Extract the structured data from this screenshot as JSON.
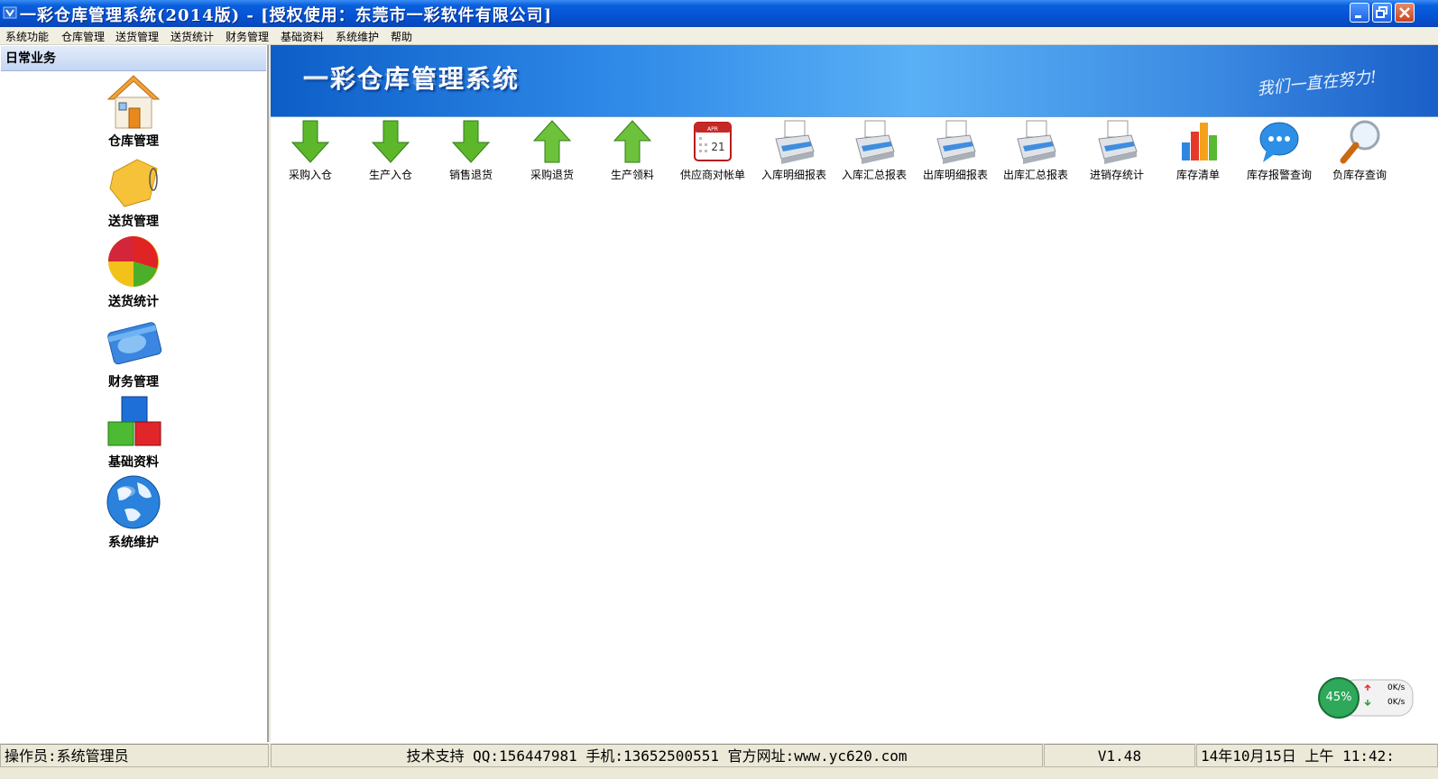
{
  "window": {
    "title": "一彩仓库管理系统(2014版) - [授权使用：东莞市一彩软件有限公司]"
  },
  "menu": [
    "系统功能",
    "仓库管理",
    "送货管理",
    "送货统计",
    "财务管理",
    "基础资料",
    "系统维护",
    "帮助"
  ],
  "sidebar": {
    "header": "日常业务",
    "items": [
      {
        "label": "仓库管理",
        "icon": "house-icon"
      },
      {
        "label": "送货管理",
        "icon": "tag-icon"
      },
      {
        "label": "送货统计",
        "icon": "pie-chart-icon"
      },
      {
        "label": "财务管理",
        "icon": "card-icon"
      },
      {
        "label": "基础资料",
        "icon": "blocks-icon"
      },
      {
        "label": "系统维护",
        "icon": "globe-icon"
      }
    ]
  },
  "banner": {
    "title": "一彩仓库管理系统",
    "slogan": "我们一直在努力!"
  },
  "toolbar": [
    {
      "label": "采购入仓",
      "icon": "arrow-down-icon"
    },
    {
      "label": "生产入仓",
      "icon": "arrow-down-icon"
    },
    {
      "label": "销售退货",
      "icon": "arrow-down-icon"
    },
    {
      "label": "采购退货",
      "icon": "arrow-up-icon"
    },
    {
      "label": "生产领料",
      "icon": "arrow-up-icon"
    },
    {
      "label": "供应商对帐单",
      "icon": "calendar-icon"
    },
    {
      "label": "入库明细报表",
      "icon": "printer-icon"
    },
    {
      "label": "入库汇总报表",
      "icon": "printer-icon"
    },
    {
      "label": "出库明细报表",
      "icon": "printer-icon"
    },
    {
      "label": "出库汇总报表",
      "icon": "printer-icon"
    },
    {
      "label": "进销存统计",
      "icon": "printer-icon"
    },
    {
      "label": "库存清单",
      "icon": "bar-chart-icon"
    },
    {
      "label": "库存报警查询",
      "icon": "speech-bubble-icon"
    },
    {
      "label": "负库存查询",
      "icon": "magnifier-icon"
    }
  ],
  "calendar": {
    "month": "APR",
    "day": "21"
  },
  "network": {
    "percent": "45%",
    "up": "0K/s",
    "down": "0K/s"
  },
  "status": {
    "operator": "操作员:系统管理员",
    "support": "技术支持 QQ:156447981 手机:13652500551 官方网址:www.yc620.com",
    "version": "V1.48",
    "datetime": "14年10月15日 上午 11:42:"
  },
  "colors": {
    "titlebar": "#0553d4",
    "arrow_green": "#5cb82a",
    "banner": "#2f8ae8"
  }
}
